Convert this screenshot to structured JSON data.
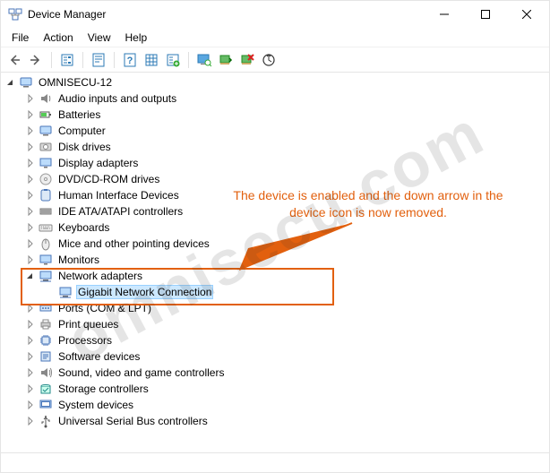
{
  "window": {
    "title": "Device Manager"
  },
  "menu": {
    "items": [
      "File",
      "Action",
      "View",
      "Help"
    ]
  },
  "toolbar": {
    "buttons": [
      {
        "name": "back",
        "icon": "arrow-left"
      },
      {
        "name": "forward",
        "icon": "arrow-right"
      },
      {
        "name": "sep"
      },
      {
        "name": "show-hidden",
        "icon": "tree-box"
      },
      {
        "name": "sep"
      },
      {
        "name": "properties",
        "icon": "props-sheet"
      },
      {
        "name": "sep"
      },
      {
        "name": "help",
        "icon": "help-q"
      },
      {
        "name": "view-mode",
        "icon": "grid-box"
      },
      {
        "name": "add-hardware",
        "icon": "tree-plus"
      },
      {
        "name": "sep"
      },
      {
        "name": "update-driver",
        "icon": "monitor-search"
      },
      {
        "name": "enable",
        "icon": "card-green"
      },
      {
        "name": "uninstall",
        "icon": "card-red-x"
      },
      {
        "name": "scan",
        "icon": "scan-circle"
      }
    ]
  },
  "tree": {
    "root": {
      "label": "OMNISECU-12",
      "icon": "computer",
      "expanded": true,
      "children": [
        {
          "label": "Audio inputs and outputs",
          "icon": "audio",
          "expandable": true
        },
        {
          "label": "Batteries",
          "icon": "battery",
          "expandable": true
        },
        {
          "label": "Computer",
          "icon": "computer",
          "expandable": true
        },
        {
          "label": "Disk drives",
          "icon": "disk",
          "expandable": true
        },
        {
          "label": "Display adapters",
          "icon": "display",
          "expandable": true
        },
        {
          "label": "DVD/CD-ROM drives",
          "icon": "disc",
          "expandable": true
        },
        {
          "label": "Human Interface Devices",
          "icon": "hid",
          "expandable": true
        },
        {
          "label": "IDE ATA/ATAPI controllers",
          "icon": "ide",
          "expandable": true
        },
        {
          "label": "Keyboards",
          "icon": "keyboard",
          "expandable": true
        },
        {
          "label": "Mice and other pointing devices",
          "icon": "mouse",
          "expandable": true
        },
        {
          "label": "Monitors",
          "icon": "monitor",
          "expandable": true
        },
        {
          "label": "Network adapters",
          "icon": "network",
          "expandable": true,
          "expanded": true,
          "children": [
            {
              "label": "Gigabit Network Connection",
              "icon": "network",
              "selected": true
            }
          ]
        },
        {
          "label": "Ports (COM & LPT)",
          "icon": "port",
          "expandable": true
        },
        {
          "label": "Print queues",
          "icon": "printer",
          "expandable": true
        },
        {
          "label": "Processors",
          "icon": "cpu",
          "expandable": true
        },
        {
          "label": "Software devices",
          "icon": "software",
          "expandable": true
        },
        {
          "label": "Sound, video and game controllers",
          "icon": "sound",
          "expandable": true
        },
        {
          "label": "Storage controllers",
          "icon": "storage",
          "expandable": true
        },
        {
          "label": "System devices",
          "icon": "system",
          "expandable": true
        },
        {
          "label": "Universal Serial Bus controllers",
          "icon": "usb",
          "expandable": true
        }
      ]
    }
  },
  "annotation": {
    "text": "The device is enabled and the down arrow in the device icon is now removed."
  },
  "watermark": "omnisecu.com"
}
